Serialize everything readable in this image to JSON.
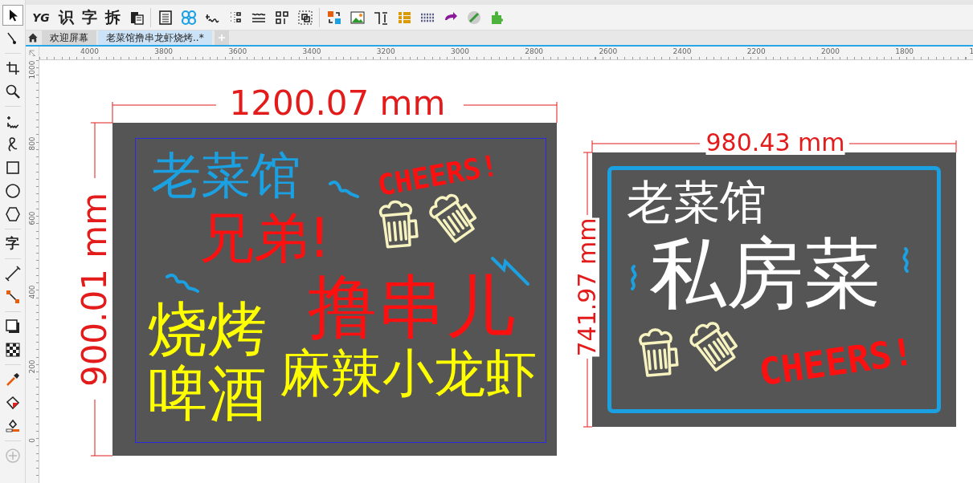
{
  "toolbar": {
    "text_tools": [
      "YG",
      "识",
      "字",
      "拆"
    ]
  },
  "toolbox": {
    "tools": [
      {
        "selected": true
      },
      {
        "selected": false
      },
      {
        "selected": false
      },
      {
        "selected": false
      },
      {
        "selected": false
      },
      {
        "selected": false
      },
      {
        "selected": false
      },
      {
        "selected": false
      },
      {
        "selected": false
      },
      {
        "label": "字",
        "selected": false
      },
      {
        "selected": false
      },
      {
        "selected": false
      },
      {
        "selected": false
      },
      {
        "selected": false
      },
      {
        "selected": false
      },
      {
        "selected": false
      },
      {
        "selected": false
      },
      {
        "selected": false
      }
    ]
  },
  "tabs": [
    {
      "label": "欢迎屏幕",
      "selected": false
    },
    {
      "label": "老菜馆撸串龙虾烧烤..*",
      "selected": true
    }
  ],
  "ruler": {
    "horizontal": [
      "4000",
      "3800",
      "3600",
      "3400",
      "3200",
      "3000",
      "2800",
      "2600",
      "2400",
      "2200",
      "2000",
      "1800",
      "1"
    ],
    "vertical": [
      "1000",
      "800",
      "600",
      "400",
      "200",
      "0"
    ]
  },
  "signs": [
    {
      "width_label": "1200.07 mm",
      "height_label": "900.01 mm",
      "texts": [
        {
          "text": "老菜馆",
          "color": "#1ba1e2"
        },
        {
          "text": "CHEERS!",
          "color": "#ff1010"
        },
        {
          "text": "兄弟!",
          "color": "#ff1010"
        },
        {
          "text": "撸串儿",
          "color": "#ff1010"
        },
        {
          "text": "烧烤",
          "color": "#ffff00"
        },
        {
          "text": "啤酒",
          "color": "#ffff00"
        },
        {
          "text": "麻辣小龙虾",
          "color": "#ffff00"
        }
      ]
    },
    {
      "width_label": "980.43 mm",
      "height_label": "741.97 mm",
      "texts": [
        {
          "text": "老菜馆",
          "color": "#ffffff"
        },
        {
          "text": "私房菜",
          "color": "#ffffff"
        },
        {
          "text": "CHEERS!",
          "color": "#ff1010"
        }
      ]
    }
  ]
}
